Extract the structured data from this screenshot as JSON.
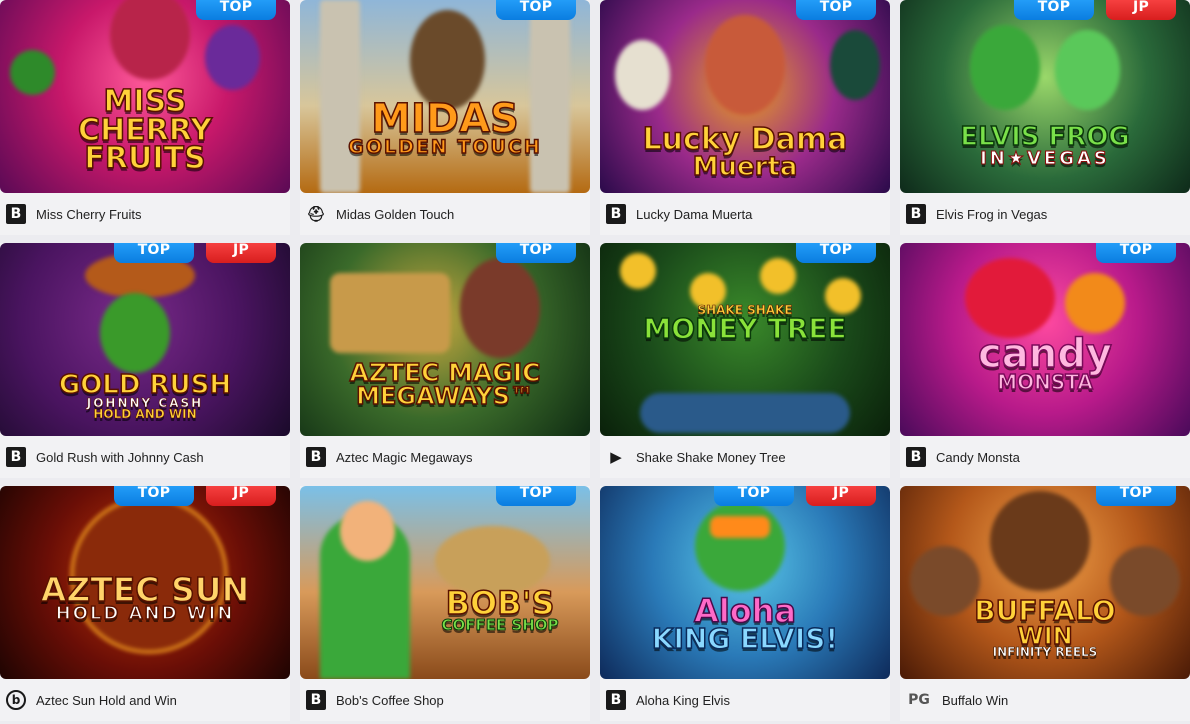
{
  "games": [
    {
      "name": "Miss Cherry Fruits",
      "provider": "B",
      "provider_icon": "b-square-icon",
      "badges": [
        "TOP"
      ],
      "art_lines": [
        "MISS",
        "CHERRY",
        "FRUITS"
      ]
    },
    {
      "name": "Midas Golden Touch",
      "provider": "⛑",
      "provider_icon": "helmet-icon",
      "badges": [
        "TOP"
      ],
      "art_lines": [
        "MIDAS",
        "GOLDEN TOUCH"
      ]
    },
    {
      "name": "Lucky Dama Muerta",
      "provider": "B",
      "provider_icon": "b-square-icon",
      "badges": [
        "TOP"
      ],
      "art_lines": [
        "Lucky Dama",
        "Muerta"
      ]
    },
    {
      "name": "Elvis Frog in Vegas",
      "provider": "B",
      "provider_icon": "b-square-icon",
      "badges": [
        "TOP",
        "JP"
      ],
      "art_lines": [
        "ELVIS FROG",
        "IN★VEGAS"
      ]
    },
    {
      "name": "Gold Rush with Johnny Cash",
      "provider": "B",
      "provider_icon": "b-square-icon",
      "badges": [
        "TOP",
        "JP"
      ],
      "art_lines": [
        "GOLD RUSH",
        "JOHNNY CASH",
        "HOLD AND WIN"
      ]
    },
    {
      "name": "Aztec Magic Megaways",
      "provider": "B",
      "provider_icon": "b-square-icon",
      "badges": [
        "TOP"
      ],
      "art_lines": [
        "AZTEC MAGIC",
        "MEGAWAYS™"
      ]
    },
    {
      "name": "Shake Shake Money Tree",
      "provider": "▶",
      "provider_icon": "play-triangle-icon",
      "badges": [
        "TOP"
      ],
      "art_lines": [
        "SHAKE SHAKE",
        "MONEY TREE"
      ]
    },
    {
      "name": "Candy Monsta",
      "provider": "B",
      "provider_icon": "b-square-icon",
      "badges": [
        "TOP"
      ],
      "art_lines": [
        "candy",
        "MONSTA"
      ]
    },
    {
      "name": "Aztec Sun Hold and Win",
      "provider": "b",
      "provider_icon": "b-circle-icon",
      "badges": [
        "TOP",
        "JP"
      ],
      "art_lines": [
        "AZTEC SUN",
        "HOLD AND WIN"
      ]
    },
    {
      "name": "Bob's Coffee Shop",
      "provider": "B",
      "provider_icon": "b-square-icon",
      "badges": [
        "TOP"
      ],
      "art_lines": [
        "BOB'S",
        "COFFEE SHOP"
      ]
    },
    {
      "name": "Aloha King Elvis",
      "provider": "B",
      "provider_icon": "b-square-icon",
      "badges": [
        "TOP",
        "JP"
      ],
      "art_lines": [
        "Aloha",
        "KING ELVIS!"
      ]
    },
    {
      "name": "Buffalo Win",
      "provider": "PG",
      "provider_icon": "pg-icon",
      "badges": [
        "TOP"
      ],
      "art_lines": [
        "BUFFALO",
        "WIN",
        "INFINITY REELS"
      ]
    }
  ],
  "colors": {
    "top_badge": "#1a8ef0",
    "jp_badge": "#e42a2a",
    "page_bg": "#ececf0"
  }
}
